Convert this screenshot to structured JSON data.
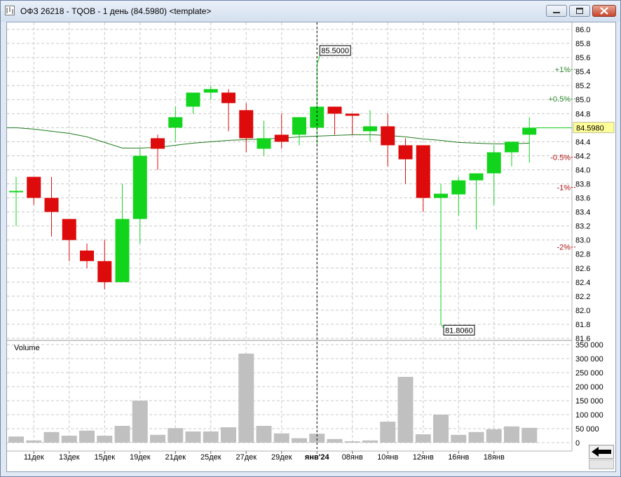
{
  "window": {
    "title": "ОФЗ 26218 - TQOB - 1 день (84.5980) <template>"
  },
  "colors": {
    "up": "#12d41c",
    "down": "#dd0b0b",
    "ma": "#1f7a1f",
    "volume": "#c0c0c0",
    "grid": "#c8c8c8",
    "price_label_bg": "#ffff99"
  },
  "icons": {
    "app": "chart-window-icon",
    "minimize": "minimize-icon",
    "maximize": "maximize-icon",
    "close": "close-icon",
    "nav": "arrow-left-icon"
  },
  "chart_data": {
    "type": "candlestick",
    "price_axis": {
      "ticks": [
        "86.0",
        "85.8",
        "85.6",
        "85.4",
        "85.2",
        "85.0",
        "84.8",
        "84.6",
        "84.4",
        "84.2",
        "84.0",
        "83.8",
        "83.6",
        "83.4",
        "83.2",
        "83.0",
        "82.8",
        "82.6",
        "82.4",
        "82.2",
        "82.0",
        "81.8",
        "81.6"
      ],
      "range": [
        81.6,
        86.0
      ]
    },
    "current_price_label": "84.5980",
    "current_price": 84.598,
    "high_marker": {
      "label": "85.5000",
      "value": 85.5
    },
    "low_marker": {
      "label": "81.8060",
      "value": 81.806
    },
    "pct_levels": [
      {
        "label": "+1%",
        "value": 85.43,
        "sign": "up"
      },
      {
        "label": "+0.5%",
        "value": 85.01,
        "sign": "up"
      },
      {
        "label": "-0.5%",
        "value": 84.18,
        "sign": "down"
      },
      {
        "label": "-1%",
        "value": 83.75,
        "sign": "down"
      },
      {
        "label": "-2%",
        "value": 82.9,
        "sign": "down"
      }
    ],
    "candles": [
      {
        "o": 83.7,
        "h": 83.9,
        "l": 83.2,
        "c": 83.7
      },
      {
        "o": 83.9,
        "h": 83.9,
        "l": 83.5,
        "c": 83.6
      },
      {
        "o": 83.6,
        "h": 83.9,
        "l": 83.05,
        "c": 83.4
      },
      {
        "o": 83.3,
        "h": 83.3,
        "l": 82.7,
        "c": 83.0
      },
      {
        "o": 82.85,
        "h": 82.95,
        "l": 82.6,
        "c": 82.7
      },
      {
        "o": 82.7,
        "h": 83.0,
        "l": 82.3,
        "c": 82.4
      },
      {
        "o": 82.4,
        "h": 83.8,
        "l": 82.4,
        "c": 83.3
      },
      {
        "o": 83.3,
        "h": 84.3,
        "l": 82.95,
        "c": 84.2
      },
      {
        "o": 84.45,
        "h": 84.5,
        "l": 84.0,
        "c": 84.3
      },
      {
        "o": 84.6,
        "h": 84.9,
        "l": 84.4,
        "c": 84.75
      },
      {
        "o": 84.9,
        "h": 85.05,
        "l": 84.8,
        "c": 85.1
      },
      {
        "o": 85.1,
        "h": 85.2,
        "l": 85.0,
        "c": 85.15
      },
      {
        "o": 85.1,
        "h": 85.15,
        "l": 84.55,
        "c": 84.95
      },
      {
        "o": 84.85,
        "h": 84.95,
        "l": 84.25,
        "c": 84.45
      },
      {
        "o": 84.3,
        "h": 84.7,
        "l": 84.2,
        "c": 84.45
      },
      {
        "o": 84.5,
        "h": 84.8,
        "l": 84.3,
        "c": 84.4
      },
      {
        "o": 84.5,
        "h": 84.75,
        "l": 84.35,
        "c": 84.75
      },
      {
        "o": 84.6,
        "h": 85.5,
        "l": 84.35,
        "c": 84.9
      },
      {
        "o": 84.9,
        "h": 84.9,
        "l": 84.5,
        "c": 84.8
      },
      {
        "o": 84.8,
        "h": 84.8,
        "l": 84.5,
        "c": 84.77
      },
      {
        "o": 84.55,
        "h": 84.85,
        "l": 84.4,
        "c": 84.62
      },
      {
        "o": 84.62,
        "h": 84.8,
        "l": 84.05,
        "c": 84.35
      },
      {
        "o": 84.35,
        "h": 84.45,
        "l": 83.8,
        "c": 84.15
      },
      {
        "o": 84.35,
        "h": 84.35,
        "l": 83.4,
        "c": 83.6
      },
      {
        "o": 83.6,
        "h": 83.8,
        "l": 81.806,
        "c": 83.66
      },
      {
        "o": 83.65,
        "h": 83.9,
        "l": 83.35,
        "c": 83.85
      },
      {
        "o": 83.85,
        "h": 83.95,
        "l": 83.15,
        "c": 83.95
      },
      {
        "o": 83.95,
        "h": 84.35,
        "l": 83.5,
        "c": 84.25
      },
      {
        "o": 84.25,
        "h": 84.4,
        "l": 84.05,
        "c": 84.4
      },
      {
        "o": 84.5,
        "h": 84.75,
        "l": 84.1,
        "c": 84.6
      }
    ],
    "moving_average": [
      84.6,
      84.58,
      84.55,
      84.52,
      84.47,
      84.39,
      84.31,
      84.31,
      84.32,
      84.35,
      84.38,
      84.4,
      84.42,
      84.43,
      84.44,
      84.45,
      84.47,
      84.48,
      84.49,
      84.5,
      84.5,
      84.49,
      84.47,
      84.44,
      84.42,
      84.39,
      84.38,
      84.37,
      84.37,
      84.38
    ],
    "volume_panel": {
      "label": "Volume",
      "ticks": [
        "350 000",
        "300 000",
        "250 000",
        "200 000",
        "150 000",
        "100 000",
        "50 000",
        "0"
      ],
      "range": [
        0,
        350000
      ],
      "values": [
        22000,
        8000,
        38000,
        25000,
        43000,
        25000,
        60000,
        150000,
        28000,
        52000,
        40000,
        40000,
        55000,
        318000,
        60000,
        33000,
        16000,
        32000,
        13000,
        5000,
        8000,
        75000,
        235000,
        30000,
        100000,
        28000,
        38000,
        48000,
        58000,
        53000
      ]
    },
    "date_labels": [
      {
        "label": "11дек",
        "index": 1,
        "bold": false
      },
      {
        "label": "13дек",
        "index": 3,
        "bold": false
      },
      {
        "label": "15дек",
        "index": 5,
        "bold": false
      },
      {
        "label": "19дек",
        "index": 7,
        "bold": false
      },
      {
        "label": "21дек",
        "index": 9,
        "bold": false
      },
      {
        "label": "25дек",
        "index": 11,
        "bold": false
      },
      {
        "label": "27дек",
        "index": 13,
        "bold": false
      },
      {
        "label": "29дек",
        "index": 15,
        "bold": false
      },
      {
        "label": "янв'24",
        "index": 17,
        "bold": true
      },
      {
        "label": "08янв",
        "index": 19,
        "bold": false
      },
      {
        "label": "10янв",
        "index": 21,
        "bold": false
      },
      {
        "label": "12янв",
        "index": 23,
        "bold": false
      },
      {
        "label": "16янв",
        "index": 25,
        "bold": false
      },
      {
        "label": "18янв",
        "index": 27,
        "bold": false
      }
    ],
    "crosshair_index": 17
  }
}
